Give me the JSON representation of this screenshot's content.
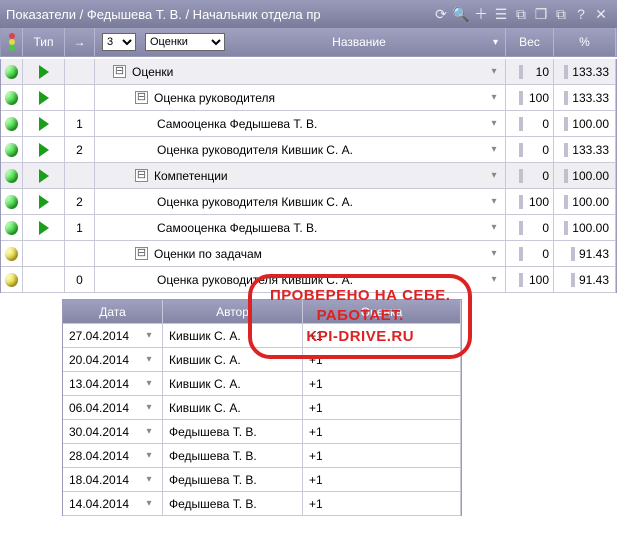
{
  "title": "Показатели / Федышева Т. В. / Начальник отдела пр",
  "toolbar_icons": [
    "refresh",
    "search",
    "plus",
    "columns",
    "export",
    "window",
    "copy",
    "help",
    "close"
  ],
  "headers": {
    "type": "Тип",
    "arrow": "→",
    "level_value": "3",
    "filter_value": "Оценки",
    "name": "Название",
    "ves": "Вес",
    "pct": "%"
  },
  "rows": [
    {
      "group": true,
      "traffic": "green",
      "play": true,
      "arrow": "",
      "indent": 0,
      "exp": "⊟",
      "name": "Оценки",
      "ves": "10",
      "pct": "133.33"
    },
    {
      "group": false,
      "traffic": "green",
      "play": true,
      "arrow": "",
      "indent": 1,
      "exp": "⊟",
      "name": "Оценка руководителя",
      "ves": "100",
      "pct": "133.33"
    },
    {
      "group": false,
      "traffic": "green",
      "play": true,
      "arrow": "1",
      "indent": 2,
      "exp": "",
      "name": "Самооценка Федышева Т. В.",
      "ves": "0",
      "pct": "100.00"
    },
    {
      "group": false,
      "traffic": "green",
      "play": true,
      "arrow": "2",
      "indent": 2,
      "exp": "",
      "name": "Оценка руководителя Кившик С. А.",
      "ves": "0",
      "pct": "133.33"
    },
    {
      "group": true,
      "traffic": "green",
      "play": true,
      "arrow": "",
      "indent": 1,
      "exp": "⊟",
      "name": "Компетенции",
      "ves": "0",
      "pct": "100.00"
    },
    {
      "group": false,
      "traffic": "green",
      "play": true,
      "arrow": "2",
      "indent": 2,
      "exp": "",
      "name": "Оценка руководителя Кившик С. А.",
      "ves": "100",
      "pct": "100.00"
    },
    {
      "group": false,
      "traffic": "green",
      "play": true,
      "arrow": "1",
      "indent": 2,
      "exp": "",
      "name": "Самооценка Федышева Т. В.",
      "ves": "0",
      "pct": "100.00"
    },
    {
      "group": false,
      "traffic": "yellow",
      "play": false,
      "arrow": "",
      "indent": 1,
      "exp": "⊟",
      "name": "Оценки по задачам",
      "ves": "0",
      "pct": "91.43"
    },
    {
      "group": false,
      "traffic": "yellow",
      "play": false,
      "arrow": "0",
      "indent": 2,
      "exp": "",
      "name": "Оценка руководителя Кившик С. А.",
      "ves": "100",
      "pct": "91.43"
    }
  ],
  "sub_headers": {
    "date": "Дата",
    "author": "Автор",
    "val": "Оценка"
  },
  "sub_rows": [
    {
      "date": "27.04.2014",
      "author": "Кившик С. А.",
      "val": "+1"
    },
    {
      "date": "20.04.2014",
      "author": "Кившик С. А.",
      "val": "+1"
    },
    {
      "date": "13.04.2014",
      "author": "Кившик С. А.",
      "val": "+1"
    },
    {
      "date": "06.04.2014",
      "author": "Кившик С. А.",
      "val": "+1"
    },
    {
      "date": "30.04.2014",
      "author": "Федышева Т. В.",
      "val": "+1"
    },
    {
      "date": "28.04.2014",
      "author": "Федышева Т. В.",
      "val": "+1"
    },
    {
      "date": "18.04.2014",
      "author": "Федышева Т. В.",
      "val": "+1"
    },
    {
      "date": "14.04.2014",
      "author": "Федышева Т. В.",
      "val": "+1"
    }
  ],
  "stamp": {
    "l1": "ПРОВЕРЕНО НА СЕБЕ.",
    "l2": "РАБОТАЕТ.",
    "l3": "KPI-DRIVE.RU"
  }
}
